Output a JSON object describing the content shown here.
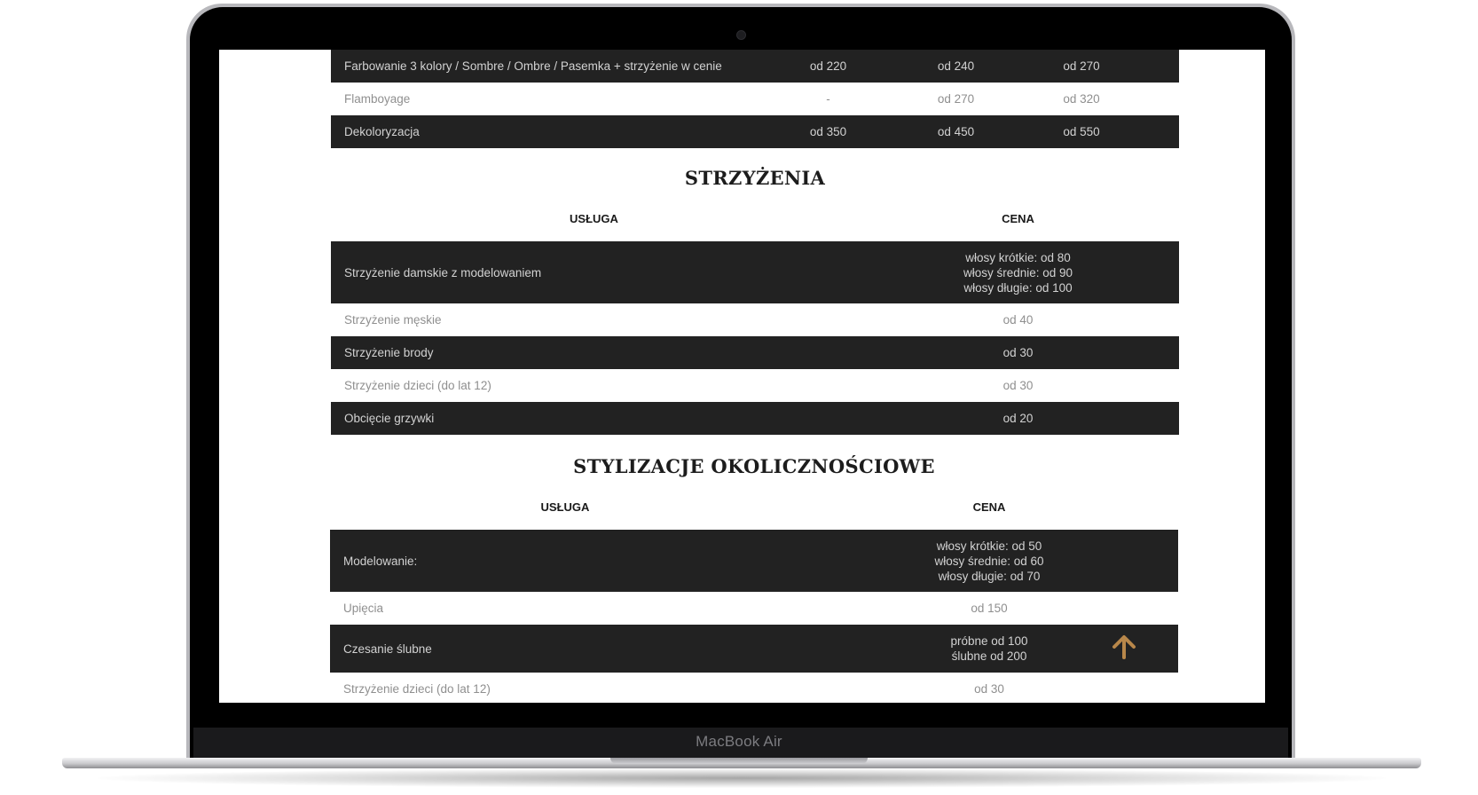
{
  "device": {
    "brand_label": "MacBook Air"
  },
  "coloring_table": {
    "rows": [
      {
        "service": "Farbowanie 3 kolory / Sombre / Ombre / Pasemka + strzyżenie w cenie",
        "price_1": "od 220",
        "price_2": "od 240",
        "price_3": "od 270"
      },
      {
        "service": "Flamboyage",
        "price_1": "-",
        "price_2": "od 270",
        "price_3": "od 320"
      },
      {
        "service": "Dekoloryzacja",
        "price_1": "od 350",
        "price_2": "od 450",
        "price_3": "od 550"
      }
    ]
  },
  "haircuts": {
    "title": "STRZYŻENIA",
    "header_service": "USŁUGA",
    "header_price": "CENA",
    "rows": [
      {
        "service": "Strzyżenie damskie z modelowaniem",
        "price_lines": [
          "włosy krótkie: od 80",
          "włosy średnie: od 90",
          "włosy długie: od 100"
        ]
      },
      {
        "service": "Strzyżenie męskie",
        "price_lines": [
          "od 40"
        ]
      },
      {
        "service": "Strzyżenie brody",
        "price_lines": [
          "od 30"
        ]
      },
      {
        "service": "Strzyżenie dzieci (do lat 12)",
        "price_lines": [
          "od 30"
        ]
      },
      {
        "service": "Obcięcie grzywki",
        "price_lines": [
          "od 20"
        ]
      }
    ]
  },
  "occasion_styling": {
    "title": "STYLIZACJE OKOLICZNOŚCIOWE",
    "header_service": "USŁUGA",
    "header_price": "CENA",
    "rows": [
      {
        "service": "Modelowanie:",
        "price_lines": [
          "włosy krótkie: od 50",
          "włosy średnie: od 60",
          "włosy długie: od 70"
        ]
      },
      {
        "service": "Upięcia",
        "price_lines": [
          "od 150"
        ]
      },
      {
        "service": "Czesanie ślubne",
        "price_lines": [
          "próbne od 100",
          "ślubne od 200"
        ]
      },
      {
        "service": "Strzyżenie dzieci (do lat 12)",
        "price_lines": [
          "od 30"
        ]
      }
    ]
  },
  "colors": {
    "row_dark": "#222222",
    "accent": "#b8874a",
    "heading": "#1c1c1c"
  },
  "icons": {
    "scroll_top": "arrow-up-icon"
  }
}
